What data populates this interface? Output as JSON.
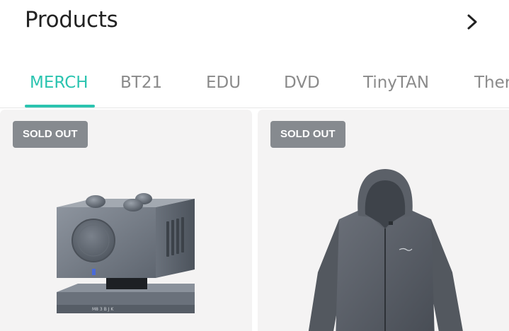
{
  "header": {
    "title": "Products",
    "chevron_icon": "chevron-right-icon"
  },
  "tabs": [
    {
      "label": "MERCH",
      "active": true
    },
    {
      "label": "BT21",
      "active": false
    },
    {
      "label": "EDU",
      "active": false
    },
    {
      "label": "DVD",
      "active": false
    },
    {
      "label": "TinyTAN",
      "active": false
    },
    {
      "label": "Ther",
      "active": false
    }
  ],
  "colors": {
    "accent": "#2bc4b0",
    "badge_bg": "#868a8f",
    "card_bg": "#f4f3f3"
  },
  "products": [
    {
      "badge": "SOLD OUT",
      "image": "speaker-cube-image",
      "device_label": "M8 3 B J K"
    },
    {
      "badge": "SOLD OUT",
      "image": "gray-hoodie-image"
    }
  ]
}
